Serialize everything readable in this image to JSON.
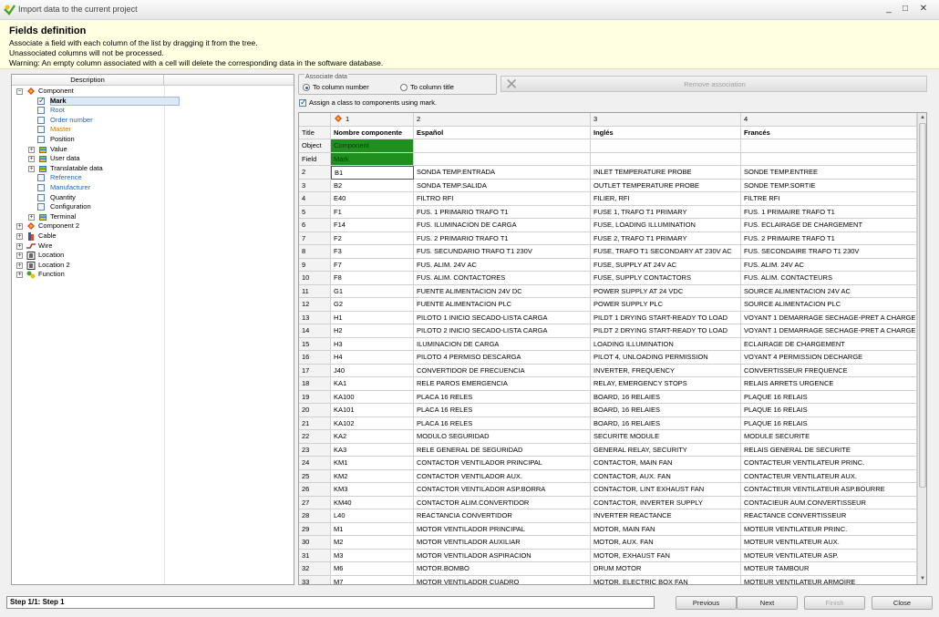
{
  "window": {
    "title": "Import data to the current project",
    "controls": [
      "_",
      "□",
      "✕"
    ]
  },
  "header": {
    "title": "Fields definition",
    "lines": [
      "Associate a field with each column of the list by dragging it from the tree.",
      "Unassociated columns will not be processed.",
      "Warning: An empty column associated with a cell will delete the corresponding data in the software database."
    ]
  },
  "tree": {
    "header": "Description",
    "items": [
      {
        "label": "Component",
        "level": 0,
        "expander": "−",
        "icon": "component-icon",
        "color": "#000000"
      },
      {
        "label": "Mark",
        "level": 1,
        "check": true,
        "checked": true,
        "bold": true,
        "selected": true,
        "color": "#000000"
      },
      {
        "label": "Root",
        "level": 1,
        "check": true,
        "checked": false,
        "color": "#1e64c8"
      },
      {
        "label": "Order number",
        "level": 1,
        "check": true,
        "checked": false,
        "color": "#1e64c8"
      },
      {
        "label": "Master",
        "level": 1,
        "check": true,
        "checked": false,
        "color": "#d07a00"
      },
      {
        "label": "Position",
        "level": 1,
        "check": true,
        "checked": false,
        "color": "#000000"
      },
      {
        "label": "Value",
        "level": 1,
        "expander": "+",
        "icon": "folder-icon",
        "color": "#000000"
      },
      {
        "label": "User data",
        "level": 1,
        "expander": "+",
        "icon": "folder-icon",
        "color": "#000000"
      },
      {
        "label": "Translatable data",
        "level": 1,
        "expander": "+",
        "icon": "folder-icon",
        "color": "#000000"
      },
      {
        "label": "Reference",
        "level": 1,
        "check": true,
        "checked": false,
        "color": "#1e64c8"
      },
      {
        "label": "Manufacturer",
        "level": 1,
        "check": true,
        "checked": false,
        "color": "#1e64c8"
      },
      {
        "label": "Quantity",
        "level": 1,
        "check": true,
        "checked": false,
        "color": "#000000"
      },
      {
        "label": "Configuration",
        "level": 1,
        "check": true,
        "checked": false,
        "color": "#000000"
      },
      {
        "label": "Terminal",
        "level": 1,
        "expander": "+",
        "icon": "folder-icon",
        "color": "#000000"
      },
      {
        "label": "Component 2",
        "level": 0,
        "expander": "+",
        "icon": "component-icon",
        "color": "#000000"
      },
      {
        "label": "Cable",
        "level": 0,
        "expander": "+",
        "icon": "cable-icon",
        "color": "#000000"
      },
      {
        "label": "Wire",
        "level": 0,
        "expander": "+",
        "icon": "wire-icon",
        "color": "#000000"
      },
      {
        "label": "Location",
        "level": 0,
        "expander": "+",
        "icon": "location-icon",
        "color": "#000000"
      },
      {
        "label": "Location 2",
        "level": 0,
        "expander": "+",
        "icon": "location-icon",
        "color": "#000000"
      },
      {
        "label": "Function",
        "level": 0,
        "expander": "+",
        "icon": "function-icon",
        "color": "#000000"
      }
    ]
  },
  "associate": {
    "title": "Associate data",
    "option_number": "To column number",
    "option_title": "To column title",
    "selected": "number",
    "remove_label": "Remove association",
    "assign_class_label": "Assign a class to components using mark.",
    "assign_class_checked": true
  },
  "grid": {
    "col_numbers": [
      "",
      "1",
      "2",
      "3",
      "4"
    ],
    "title_row": [
      "Title",
      "Nombre componente",
      "Español",
      "Inglés",
      "Francés"
    ],
    "object_row": [
      "Object",
      "Component",
      "",
      "",
      ""
    ],
    "field_row": [
      "Field",
      "Mark",
      "",
      "",
      ""
    ],
    "rows": [
      [
        "2",
        "B1",
        "SONDA TEMP.ENTRADA",
        "INLET TEMPERATURE PROBE",
        "SONDE TEMP.ENTREE"
      ],
      [
        "3",
        "B2",
        "SONDA TEMP.SALIDA",
        "OUTLET TEMPERATURE PROBE",
        "SONDE TEMP.SORTIE"
      ],
      [
        "4",
        "E40",
        "FILTRO RFI",
        "FILIER, RFI",
        "FILTRE RFI"
      ],
      [
        "5",
        "F1",
        "FUS. 1 PRIMARIO TRAFO T1",
        "FUSE 1, TRAFO T1 PRIMARY",
        "FUS. 1 PRIMAIRE TRAFO T1"
      ],
      [
        "6",
        "F14",
        "FUS. ILUMINACION DE CARGA",
        "FUSE, LOADING ILLUMINATION",
        "FUS. ECLAIRAGE DE CHARGEMENT"
      ],
      [
        "7",
        "F2",
        "FUS. 2 PRIMARIO TRAFO T1",
        "FUSE 2, TRAFO T1 PRIMARY",
        "FUS. 2 PRIMAIRE TRAFO T1"
      ],
      [
        "8",
        "F3",
        "FUS. SECUNDARIO TRAFO T1 230V",
        "FUSE, TRAFO T1 SECONDARY AT 230V AC",
        "FUS. SECONDAIRE TRAFO T1 230V"
      ],
      [
        "9",
        "F7",
        "FUS. ALIM. 24V AC",
        "FUSE, SUPPLY AT 24V AC",
        "FUS. ALIM. 24V AC"
      ],
      [
        "10",
        "F8",
        "FUS. ALIM. CONTACTORES",
        "FUSE, SUPPLY CONTACTORS",
        "FUS. ALIM. CONTACTEURS"
      ],
      [
        "11",
        "G1",
        "FUENTE ALIMENTACION 24V DC",
        "POWER SUPPLY AT 24 VDC",
        "SOURCE ALIMENTACION 24V AC"
      ],
      [
        "12",
        "G2",
        "FUENTE ALIMENTACION PLC",
        "POWER SUPPLY PLC",
        "SOURCE ALIMENTACION PLC"
      ],
      [
        "13",
        "H1",
        "PILOTO 1 INICIO SECADO-LISTA CARGA",
        "PILDT 1 DRYING START-READY TO LOAD",
        "VOYANT 1 DEMARRAGE SECHAGE-PRET A CHARGE"
      ],
      [
        "14",
        "H2",
        "PILOTO 2 INICIO SECADO-LISTA CARGA",
        "PILDT 2 DRYING START-READY TO LOAD",
        "VOYANT 1 DEMARRAGE SECHAGE-PRET A CHARGE"
      ],
      [
        "15",
        "H3",
        "ILUMINACION DE CARGA",
        "LOADING ILLUMINATION",
        "ECLAIRAGE DE CHARGEMENT"
      ],
      [
        "16",
        "H4",
        "PILOTO 4 PERMISO DESCARGA",
        "PILOT 4, UNLOADING PERMISSION",
        "VOYANT 4 PERMISSION DECHARGE"
      ],
      [
        "17",
        "J40",
        "CONVERTIDOR DE FRECUENCIA",
        "INVERTER, FREQUENCY",
        "CONVERTISSEUR FREQUENCE"
      ],
      [
        "18",
        "KA1",
        "RELE PAROS EMERGENCIA",
        "RELAY, EMERGENCY STOPS",
        "RELAIS ARRETS URGENCE"
      ],
      [
        "19",
        "KA100",
        "PLACA 16 RELES",
        "BOARD, 16 RELAIES",
        "PLAQUE 16 RELAIS"
      ],
      [
        "20",
        "KA101",
        "PLACA 16 RELES",
        "BOARD, 16 RELAIES",
        "PLAQUE 16 RELAIS"
      ],
      [
        "21",
        "KA102",
        "PLACA 16 RELES",
        "BOARD, 16 RELAIES",
        "PLAQUE 16 RELAIS"
      ],
      [
        "22",
        "KA2",
        "MODULO SEGURIDAD",
        "SECURITE MODULE",
        "MODULE SECURITE"
      ],
      [
        "23",
        "KA3",
        "RELE GENERAL DE SEGURIDAD",
        "GENERAL RELAY, SECURITY",
        "RELAIS GENERAL DE SECURITE"
      ],
      [
        "24",
        "KM1",
        "CONTACTOR VENTILADOR PRINCIPAL",
        "CONTACTOR, MAIN FAN",
        "CONTACTEUR VENTILATEUR PRINC."
      ],
      [
        "25",
        "KM2",
        "CONTACTOR VENTILADOR AUX.",
        "CONTACTOR, AUX. FAN",
        "CONTACTEUR VENTILATEUR AUX."
      ],
      [
        "26",
        "KM3",
        "CONTACTOR VENTILADOR ASP.BORRA",
        "CONTACTOR, LINT EXHAUST FAN",
        "CONTACTEUR VENTILATEUR ASP.BOURRE"
      ],
      [
        "27",
        "KM40",
        "CONTACTOR ALIM.CONVERTIDOR",
        "CONTACTOR, INVERTER SUPPLY",
        "CONTACIEUR AUM.CONVERTISSEUR"
      ],
      [
        "28",
        "L40",
        "REACTANCIA CONVERTIDOR",
        "INVERTER REACTANCE",
        "REACTANCE CONVERTISSEUR"
      ],
      [
        "29",
        "M1",
        "MOTOR VENTILADOR PRINCIPAL",
        "MOTOR, MAIN FAN",
        "MOTEUR VENTILATEUR PRINC."
      ],
      [
        "30",
        "M2",
        "MOTOR VENTILADOR AUXILIAR",
        "MOTOR, AUX. FAN",
        "MOTEUR VENTILATEUR AUX."
      ],
      [
        "31",
        "M3",
        "MOTOR VENTILADOR ASPIRACION",
        "MOTOR, EXHAUST FAN",
        "MOTEUR VENTILATEUR ASP."
      ],
      [
        "32",
        "M6",
        "MOTOR.BOMBO",
        "DRUM MOTOR",
        "MOTEUR TAMBOUR"
      ],
      [
        "33",
        "M7",
        "MOTOR VENTILADOR CUADRO",
        "MOTOR, ELECTRIC BOX FAN",
        "MOTEUR VENTILATEUR ARMOIRE"
      ]
    ]
  },
  "footer": {
    "status": "Step 1/1: Step 1",
    "previous": "Previous",
    "next": "Next",
    "finish": "Finish",
    "close": "Close"
  },
  "colors": {
    "header_bg": "#ffffe1",
    "assoc_green": "#1f8f1f",
    "link_blue": "#1e64c8",
    "master_orange": "#d07a00"
  }
}
